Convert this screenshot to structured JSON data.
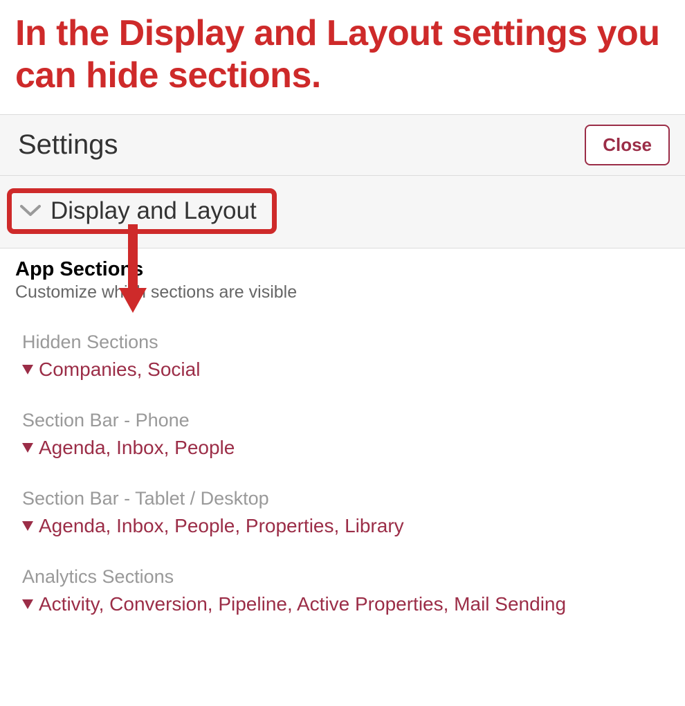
{
  "caption": "In the Display and Layout settings you can hide sections.",
  "header": {
    "title": "Settings",
    "close_label": "Close"
  },
  "section_header": "Display and Layout",
  "app_sections": {
    "title": "App Sections",
    "subtitle": "Customize which sections are visible"
  },
  "groups": {
    "hidden": {
      "label": "Hidden Sections",
      "values": "Companies, Social"
    },
    "phone": {
      "label": "Section Bar - Phone",
      "values": "Agenda, Inbox, People"
    },
    "desktop": {
      "label": "Section Bar - Tablet / Desktop",
      "values": "Agenda, Inbox, People, Properties, Library"
    },
    "analytics": {
      "label": "Analytics Sections",
      "values": "Activity, Conversion, Pipeline, Active Properties, Mail Sending"
    }
  }
}
